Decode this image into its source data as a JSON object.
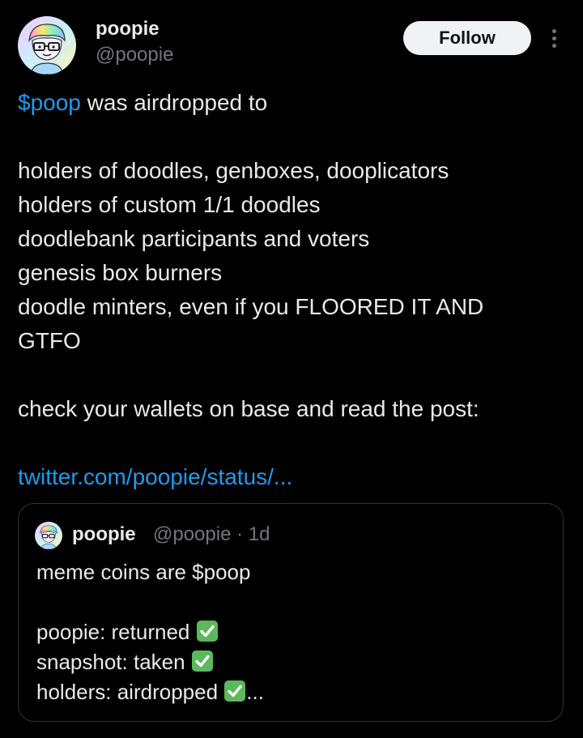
{
  "author": {
    "display_name": "poopie",
    "handle": "@poopie"
  },
  "actions": {
    "follow_label": "Follow"
  },
  "tweet": {
    "cashtag": "$poop",
    "line1_rest": " was airdropped to",
    "line2": "holders of doodles, genboxes, dooplicators",
    "line3": "holders of custom 1/1 doodles",
    "line4": "doodlebank participants and voters",
    "line5": "genesis box burners",
    "line6": "doodle minters, even if you FLOORED IT AND",
    "line7": "GTFO",
    "line8": "check your wallets on base and read the post:",
    "link": "twitter.com/poopie/status/..."
  },
  "quote": {
    "display_name": "poopie",
    "meta": "@poopie · 1d",
    "line1": "meme coins are $poop",
    "line2": "poopie: returned ",
    "line3": "snapshot: taken ",
    "line4": "holders: airdropped ",
    "ellipsis": "..."
  },
  "icons": {
    "avatar": "doodle-avatar-icon",
    "more": "more-options-icon",
    "check": "check-mark-emoji-icon"
  },
  "colors": {
    "background": "#000000",
    "text": "#e7e9ea",
    "secondary_text": "#71767b",
    "link": "#1d9bf0",
    "follow_button_bg": "#eff3f4",
    "check_green": "#5cb85c"
  }
}
